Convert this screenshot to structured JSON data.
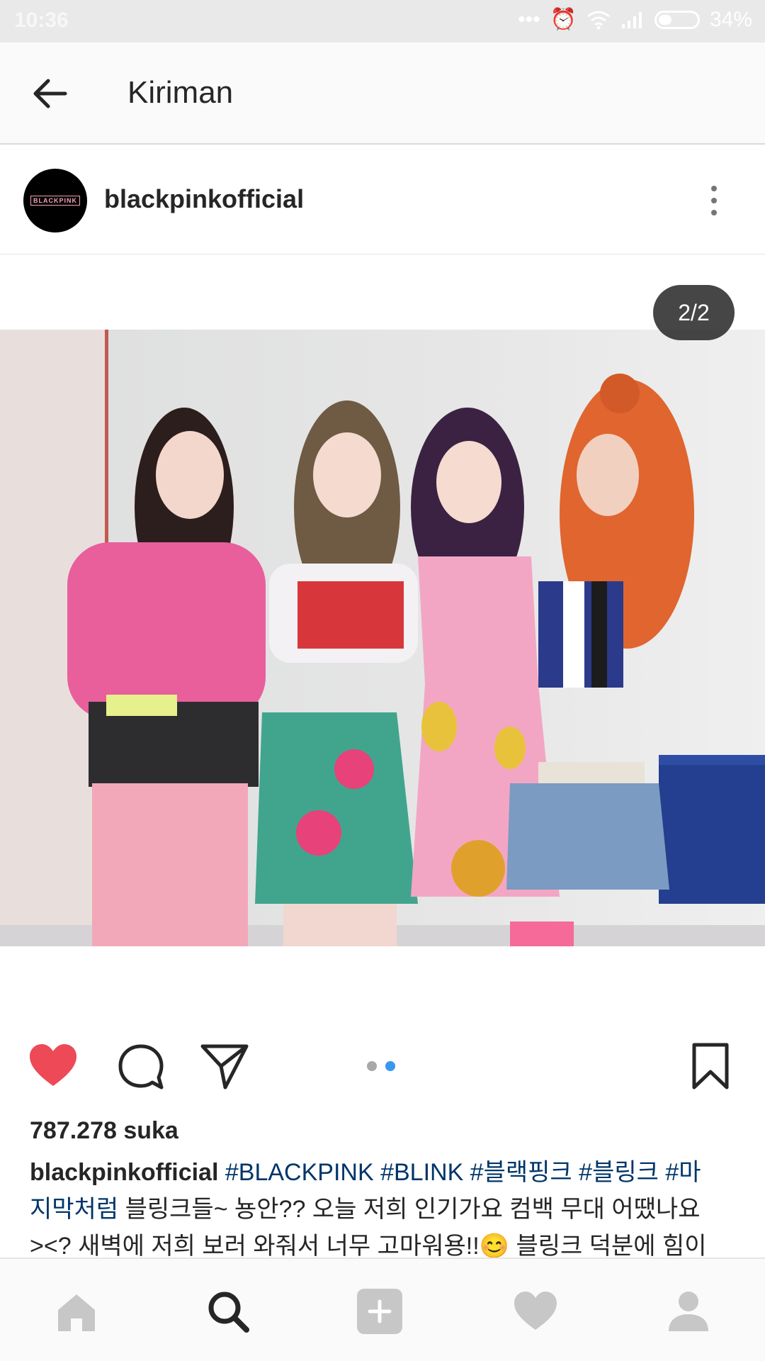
{
  "status_bar": {
    "time": "10:36",
    "battery": "34%",
    "icons": [
      "more-dots-icon",
      "alarm-icon",
      "wifi-icon",
      "signal-icon",
      "battery-icon"
    ]
  },
  "app_bar": {
    "title": "Kiriman",
    "back_icon": "arrow-left-icon"
  },
  "post": {
    "username": "blackpinkofficial",
    "avatar_logo": "BLACKPINK",
    "media_counter": "2/2",
    "media_index": 2,
    "media_total": 2,
    "likes": "787.278 suka",
    "caption": {
      "username": "blackpinkofficial",
      "line1_tags": "#BLACKPINK #BLINK #블랙핑크 #블링크 #마",
      "line2_tag": "지막처럼",
      "line2_text": " 블링크들~ 뇽안?? 오늘 저희 인기가요 컴백 무대 어땠나요",
      "line3_text": "><? 새벽에 저희 보러 와줘서 너무 고마워용!!😊 블링크 덕분에 힘이"
    }
  },
  "colors": {
    "like_red": "#ed4956",
    "active_dot": "#3897f0",
    "inactive_dot": "#a8a8a8",
    "nav_inactive": "#c7c7c7"
  },
  "bottom_nav": [
    "home-icon",
    "search-icon",
    "add-icon",
    "heart-icon",
    "profile-icon"
  ]
}
